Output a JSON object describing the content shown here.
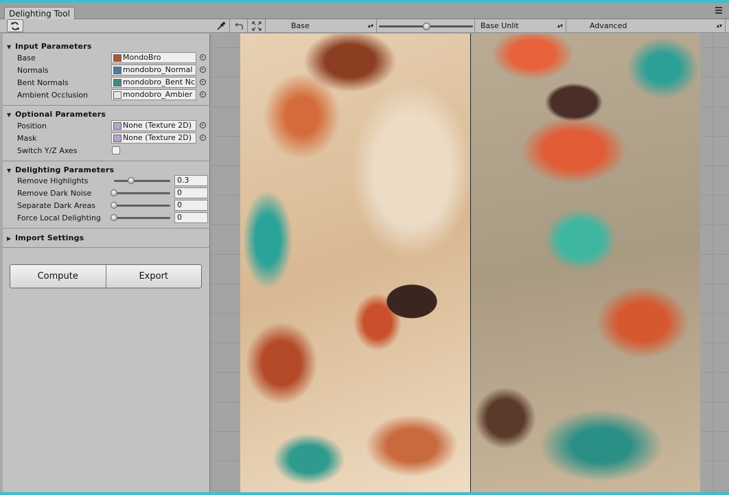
{
  "window": {
    "tab_title": "Delighting Tool"
  },
  "toolbar": {
    "refresh_icon": "refresh-icon",
    "eyedropper_icon": "eyedropper-icon",
    "undo_icon": "undo-icon",
    "fit_icon": "fit-view-icon",
    "left_view": "Base",
    "compare_slider": 0.5,
    "right_view": "Base Unlit",
    "mode": "Advanced"
  },
  "sections": {
    "input": "Input Parameters",
    "optional": "Optional Parameters",
    "delighting": "Delighting Parameters",
    "import": "Import Settings"
  },
  "input_params": [
    {
      "label": "Base",
      "value": "MondoBro",
      "thumb_color": "#b4552f"
    },
    {
      "label": "Normals",
      "value": "mondobro_Normal",
      "thumb_color": "#4e7a9e"
    },
    {
      "label": "Bent Normals",
      "value": "mondobro_Bent Nc",
      "thumb_color": "#3f8a85"
    },
    {
      "label": "Ambient Occlusion",
      "value": "mondobro_Ambier",
      "thumb_color": "#e8e8e8"
    }
  ],
  "optional_params": {
    "position": {
      "label": "Position",
      "value": "None (Texture 2D)",
      "thumb_color": "#b8a6c8"
    },
    "mask": {
      "label": "Mask",
      "value": "None (Texture 2D)",
      "thumb_color": "#b8a6c8"
    },
    "switch_axes": {
      "label": "Switch Y/Z Axes",
      "checked": false
    }
  },
  "delighting_params": [
    {
      "label": "Remove Highlights",
      "value": "0.3",
      "level": 0.3
    },
    {
      "label": "Remove Dark Noise",
      "value": "0",
      "level": 0
    },
    {
      "label": "Separate Dark Areas",
      "value": "0",
      "level": 0
    },
    {
      "label": "Force Local Delighting",
      "value": "0",
      "level": 0
    }
  ],
  "buttons": {
    "compute": "Compute",
    "export": "Export"
  }
}
